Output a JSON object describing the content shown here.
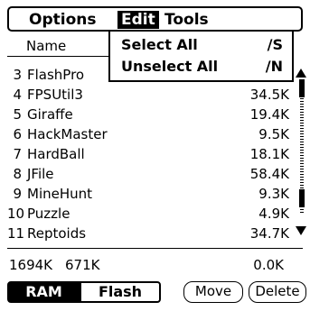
{
  "menubar": {
    "options": "Options",
    "edit": "Edit",
    "tools": "Tools"
  },
  "edit_menu": {
    "items": [
      {
        "label": "Select All",
        "shortcut": "∕S"
      },
      {
        "label": "Unselect All",
        "shortcut": "∕N"
      }
    ]
  },
  "header": {
    "name": "Name"
  },
  "list": {
    "rows": [
      {
        "num": "3",
        "name": "FlashPro",
        "size": ""
      },
      {
        "num": "4",
        "name": "FPSUtil3",
        "size": "34.5K"
      },
      {
        "num": "5",
        "name": "Giraffe",
        "size": "19.4K"
      },
      {
        "num": "6",
        "name": "HackMaster",
        "size": "9.5K"
      },
      {
        "num": "7",
        "name": "HardBall",
        "size": "18.1K"
      },
      {
        "num": "8",
        "name": "JFile",
        "size": "58.4K"
      },
      {
        "num": "9",
        "name": "MineHunt",
        "size": "9.3K"
      },
      {
        "num": "10",
        "name": "Puzzle",
        "size": "4.9K"
      },
      {
        "num": "11",
        "name": "Reptoids",
        "size": "34.7K"
      }
    ]
  },
  "totals": {
    "total": "1694K",
    "free": "671K",
    "selected": "0.0K"
  },
  "buttons": {
    "ram": "RAM",
    "flash": "Flash",
    "move": "Move",
    "delete": "Delete"
  },
  "icons": {
    "scroll_up": "triangle-up",
    "scroll_down": "triangle-down"
  }
}
